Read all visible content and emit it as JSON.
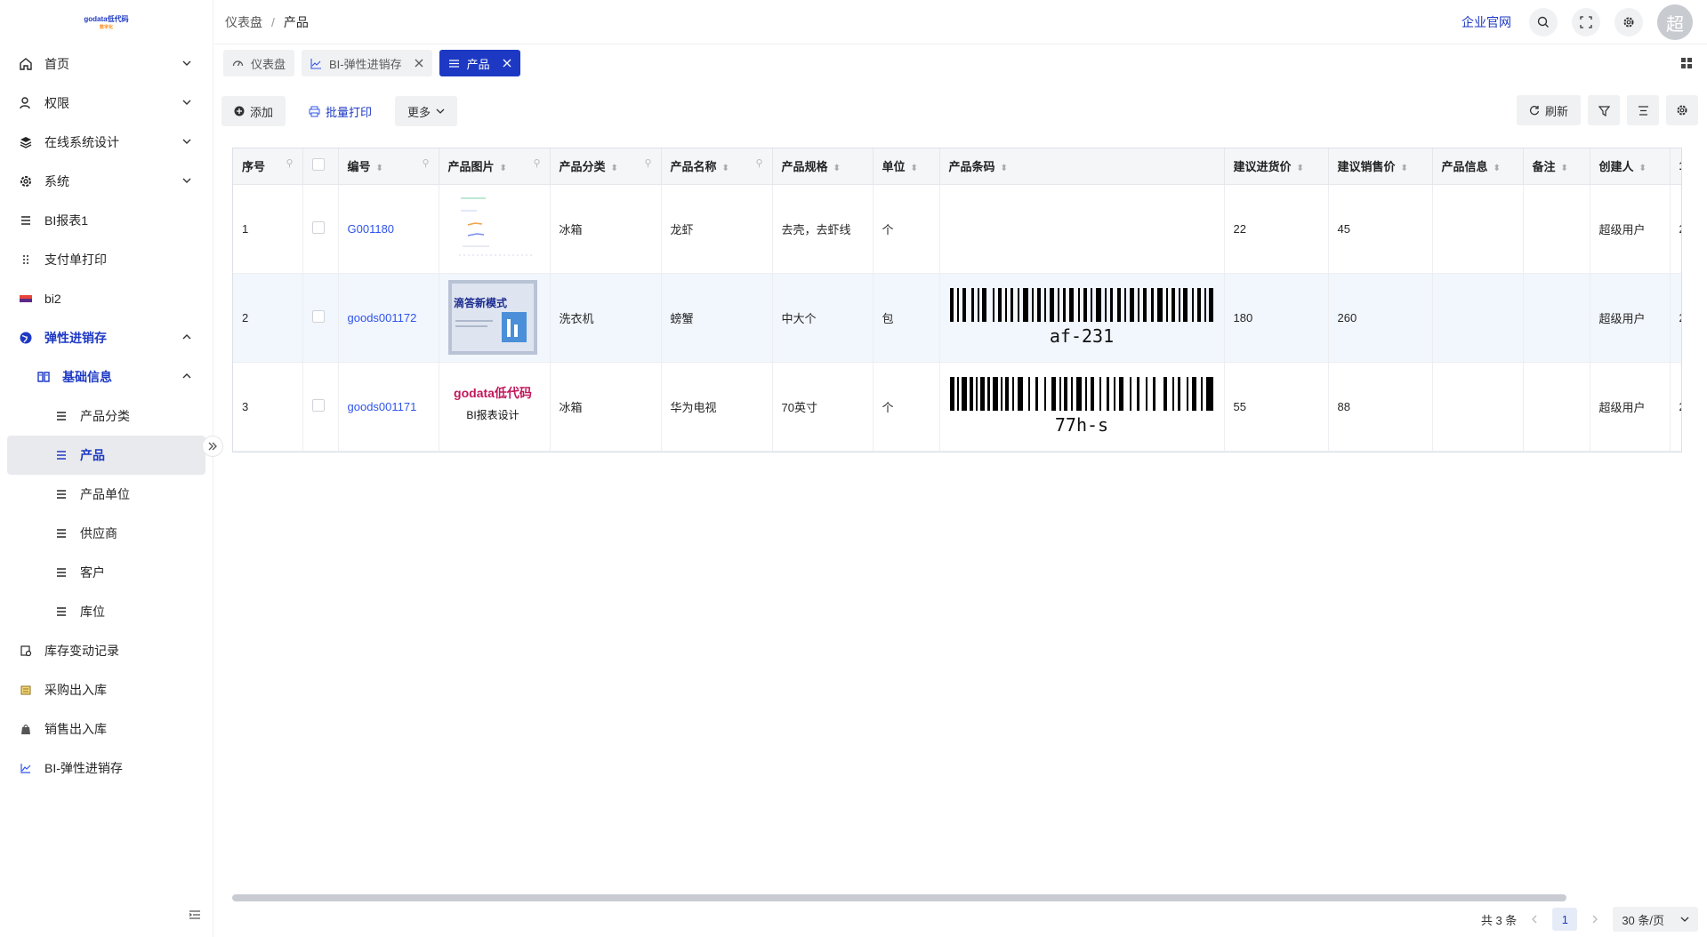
{
  "logo": {
    "text": "godata低代码",
    "sub": "数字化"
  },
  "header": {
    "breadcrumb": [
      "仪表盘",
      "产品"
    ],
    "link_label": "企业官网",
    "avatar_text": "超"
  },
  "sidebar": {
    "items": [
      {
        "label": "首页",
        "icon": "home-icon"
      },
      {
        "label": "权限",
        "icon": "user-key-icon"
      },
      {
        "label": "在线系统设计",
        "icon": "layers-icon"
      },
      {
        "label": "系统",
        "icon": "gear-icon"
      },
      {
        "label": "BI报表1",
        "icon": "list-icon"
      },
      {
        "label": "支付单打印",
        "icon": "dots-icon"
      },
      {
        "label": "bi2",
        "icon": "flag-icon"
      },
      {
        "label": "弹性进销存",
        "icon": "globe-icon"
      },
      {
        "label": "基础信息",
        "icon": "book-icon"
      },
      {
        "label": "产品分类",
        "icon": "list-icon"
      },
      {
        "label": "产品",
        "icon": "list-icon"
      },
      {
        "label": "产品单位",
        "icon": "list-icon"
      },
      {
        "label": "供应商",
        "icon": "list-icon"
      },
      {
        "label": "客户",
        "icon": "list-icon"
      },
      {
        "label": "库位",
        "icon": "list-icon"
      },
      {
        "label": "库存变动记录",
        "icon": "record-icon"
      },
      {
        "label": "采购出入库",
        "icon": "inbox-icon"
      },
      {
        "label": "销售出入库",
        "icon": "bag-icon"
      },
      {
        "label": "BI-弹性进销存",
        "icon": "chart-icon"
      }
    ]
  },
  "tabs": [
    {
      "label": "仪表盘"
    },
    {
      "label": "BI-弹性进销存"
    },
    {
      "label": "产品"
    }
  ],
  "toolbar": {
    "add_label": "添加",
    "print_label": "批量打印",
    "more_label": "更多",
    "refresh_label": "刷新"
  },
  "table": {
    "columns": [
      "序号",
      "编号",
      "产品图片",
      "产品分类",
      "产品名称",
      "产品规格",
      "单位",
      "产品条码",
      "建议进货价",
      "建议销售价",
      "产品信息",
      "备注",
      "创建人"
    ],
    "rows": [
      {
        "seq": "1",
        "code": "G001180",
        "category": "冰箱",
        "name": "龙虾",
        "spec": "去壳，去虾线",
        "unit": "个",
        "barcode": "",
        "buy": "22",
        "sell": "45",
        "info": "",
        "remark": "",
        "creator": "超级用户",
        "extra": "2"
      },
      {
        "seq": "2",
        "code": "goods001172",
        "category": "洗衣机",
        "name": "螃蟹",
        "spec": "中大个",
        "unit": "包",
        "barcode": "af-231",
        "buy": "180",
        "sell": "260",
        "info": "",
        "remark": "",
        "creator": "超级用户",
        "extra": "2"
      },
      {
        "seq": "3",
        "code": "goods001171",
        "category": "冰箱",
        "name": "华为电视",
        "spec": "70英寸",
        "unit": "个",
        "barcode": "77h-s",
        "buy": "55",
        "sell": "88",
        "info": "",
        "remark": "",
        "creator": "超级用户",
        "extra": "2"
      }
    ],
    "row2_img_text": "滴答新模式",
    "row3_img_title": "godata低代码",
    "row3_img_sub": "BI报表设计",
    "extra_col": "1"
  },
  "pager": {
    "total_label": "共 3 条",
    "page": "1",
    "size_label": "30 条/页"
  },
  "colors": {
    "primary": "#1d39c4",
    "link": "#2f54eb",
    "highlight_row": "#f2f6fd"
  }
}
